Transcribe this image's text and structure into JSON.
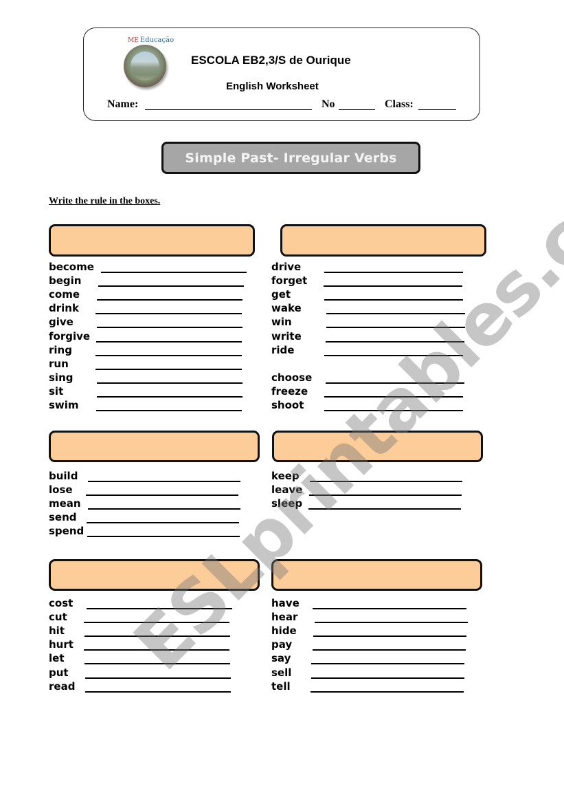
{
  "header": {
    "logo_text": "Educação",
    "logo_mark": "ME",
    "school_name": "ESCOLA EB2,3/S de Ourique",
    "worksheet_title": "English Worksheet",
    "name_label": "Name:",
    "name_value": "",
    "number_label": "No",
    "number_value": "",
    "class_label": "Class:",
    "class_value": ""
  },
  "banner": {
    "title": "Simple Past- Irregular Verbs"
  },
  "instruction": "Write the rule in the boxes.",
  "colors": {
    "rule_box_fill": "#fccc99",
    "banner_fill": "#a6a6a6",
    "banner_text": "#f4f4f4"
  },
  "groups": [
    {
      "rule": "",
      "verbs": [
        "become",
        "begin",
        "come",
        "drink",
        "give",
        "forgive",
        "ring",
        "run",
        "sing",
        "sit",
        "swim"
      ]
    },
    {
      "rule": "",
      "verbs": [
        "drive",
        "forget",
        "get",
        "wake",
        "win",
        "write",
        "ride",
        "choose",
        "freeze",
        "shoot"
      ]
    },
    {
      "rule": "",
      "verbs": [
        "build",
        "lose",
        "mean",
        "send",
        "spend"
      ]
    },
    {
      "rule": "",
      "verbs": [
        "keep",
        "leave",
        "sleep"
      ]
    },
    {
      "rule": "",
      "verbs": [
        "cost",
        "cut",
        "hit",
        "hurt",
        "let",
        "put",
        "read"
      ]
    },
    {
      "rule": "",
      "verbs": [
        "have",
        "hear",
        "hide",
        "pay",
        "say",
        "sell",
        "tell"
      ]
    }
  ],
  "watermark": "ESLprintables.com"
}
